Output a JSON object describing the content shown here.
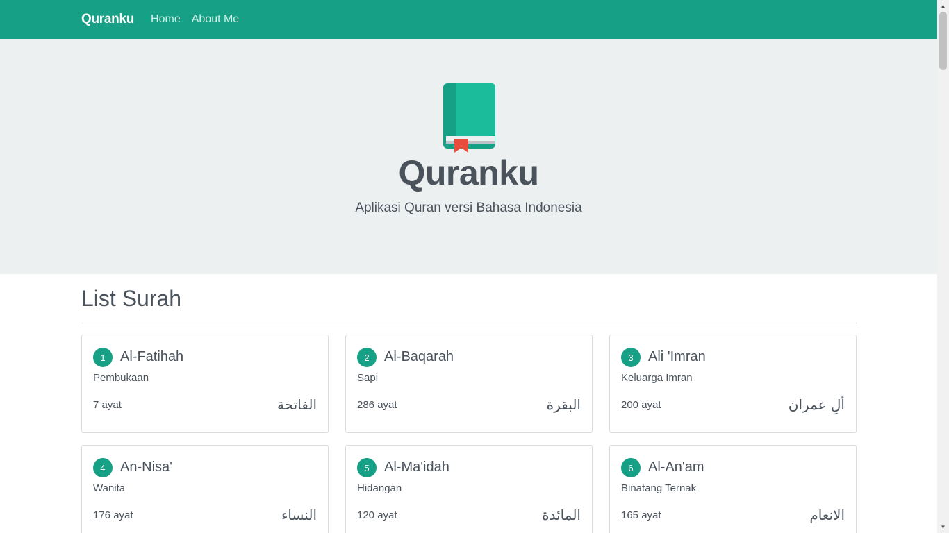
{
  "navbar": {
    "brand": "Quranku",
    "links": [
      "Home",
      "About Me"
    ]
  },
  "hero": {
    "icon": "book-icon",
    "title": "Quranku",
    "subtitle": "Aplikasi Quran versi Bahasa Indonesia"
  },
  "list": {
    "title": "List Surah",
    "surahs": [
      {
        "number": "1",
        "name": "Al-Fatihah",
        "meaning": "Pembukaan",
        "ayat": "7 ayat",
        "arabic": "الفاتحة"
      },
      {
        "number": "2",
        "name": "Al-Baqarah",
        "meaning": "Sapi",
        "ayat": "286 ayat",
        "arabic": "البقرة"
      },
      {
        "number": "3",
        "name": "Ali 'Imran",
        "meaning": "Keluarga Imran",
        "ayat": "200 ayat",
        "arabic": "ألِ عمران"
      },
      {
        "number": "4",
        "name": "An-Nisa'",
        "meaning": "Wanita",
        "ayat": "176 ayat",
        "arabic": "النساء"
      },
      {
        "number": "5",
        "name": "Al-Ma'idah",
        "meaning": "Hidangan",
        "ayat": "120 ayat",
        "arabic": "المائدة"
      },
      {
        "number": "6",
        "name": "Al-An'am",
        "meaning": "Binatang Ternak",
        "ayat": "165 ayat",
        "arabic": "الانعام"
      }
    ]
  },
  "colors": {
    "accent": "#16a085",
    "hero_bg": "#ecf0f1",
    "text": "#4a525c",
    "bookmark": "#e74c3c"
  }
}
